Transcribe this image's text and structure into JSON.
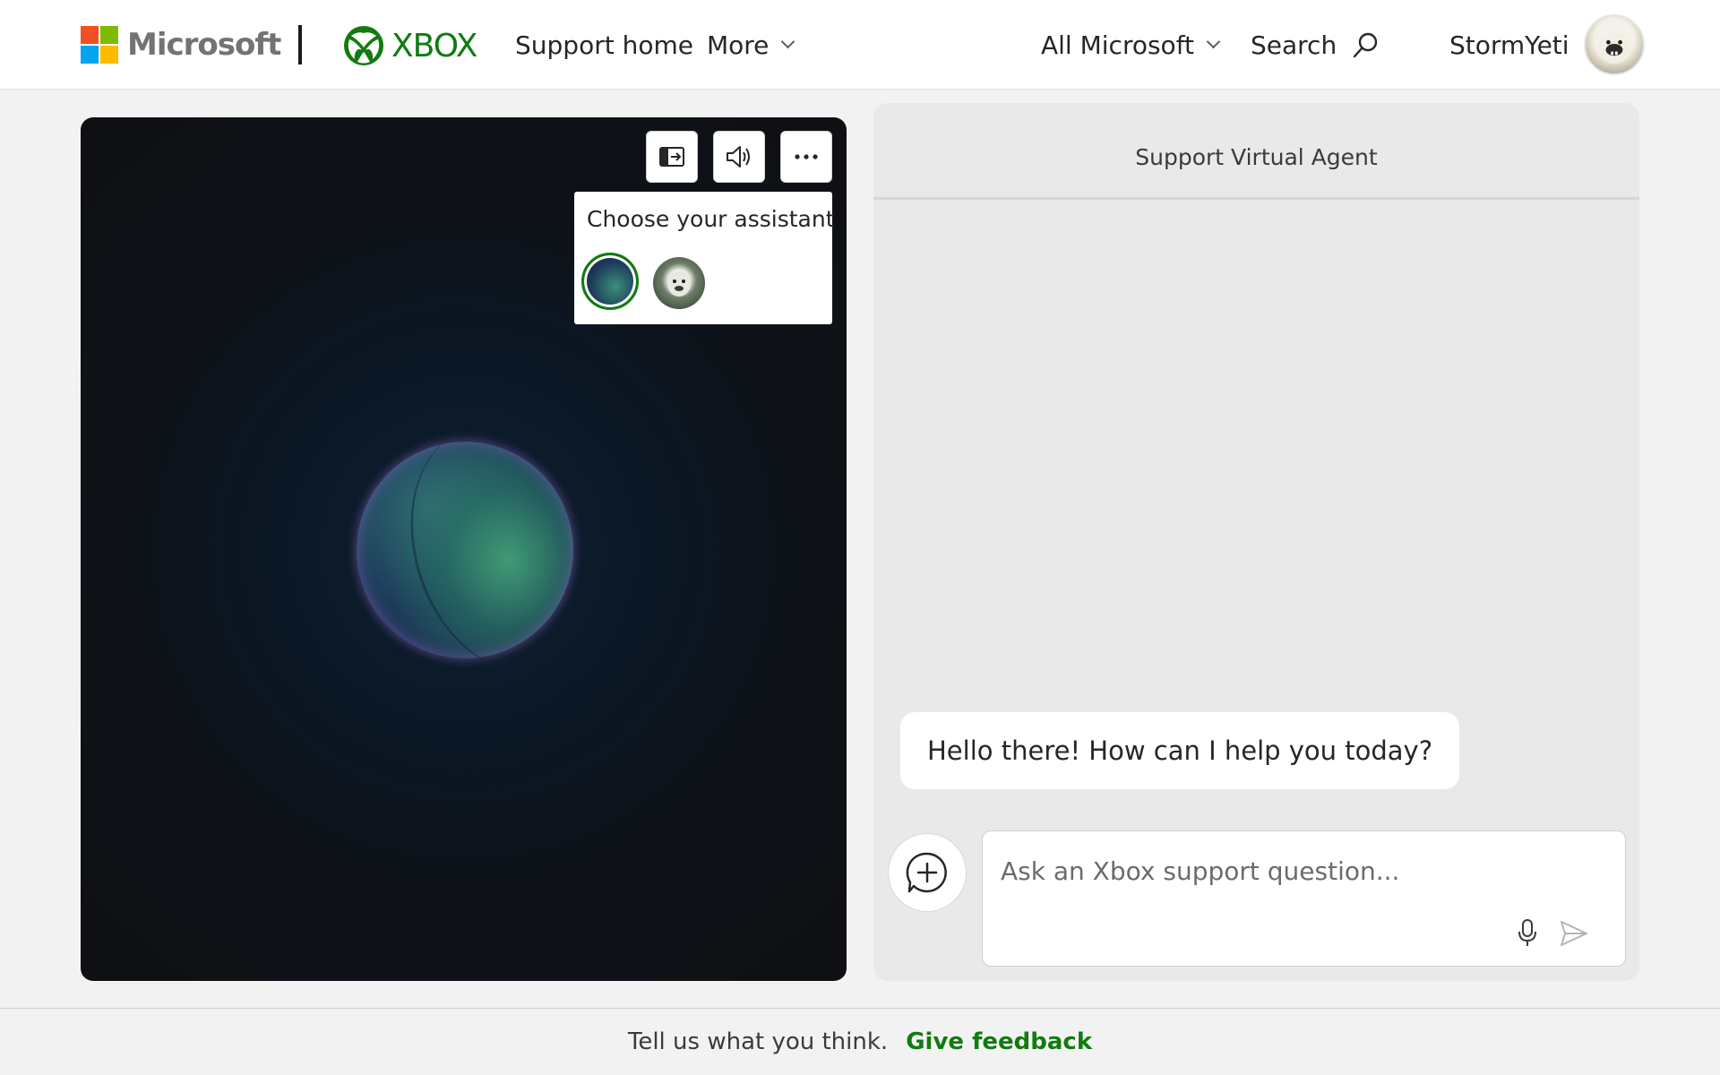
{
  "header": {
    "microsoft_label": "Microsoft",
    "xbox_label": "XBOX",
    "nav": {
      "support_home": "Support home",
      "more": "More",
      "all_microsoft": "All Microsoft",
      "search": "Search"
    },
    "user_name": "StormYeti"
  },
  "assistant_panel": {
    "popover_title": "Choose your assistant",
    "options": [
      "orb-assistant",
      "yeti-assistant"
    ],
    "selected_option": "orb-assistant"
  },
  "chat": {
    "title": "Support Virtual Agent",
    "messages": [
      {
        "from": "agent",
        "text": "Hello there! How can I help you today?"
      }
    ],
    "input": {
      "placeholder": "Ask an Xbox support question...",
      "value": ""
    }
  },
  "footer": {
    "prompt": "Tell us what you think.",
    "link": "Give feedback"
  },
  "colors": {
    "xbox_green": "#107c10",
    "page_bg": "#f2f2f2",
    "stage_bg": "#0f1013",
    "chat_bg": "#e9e9e9"
  }
}
